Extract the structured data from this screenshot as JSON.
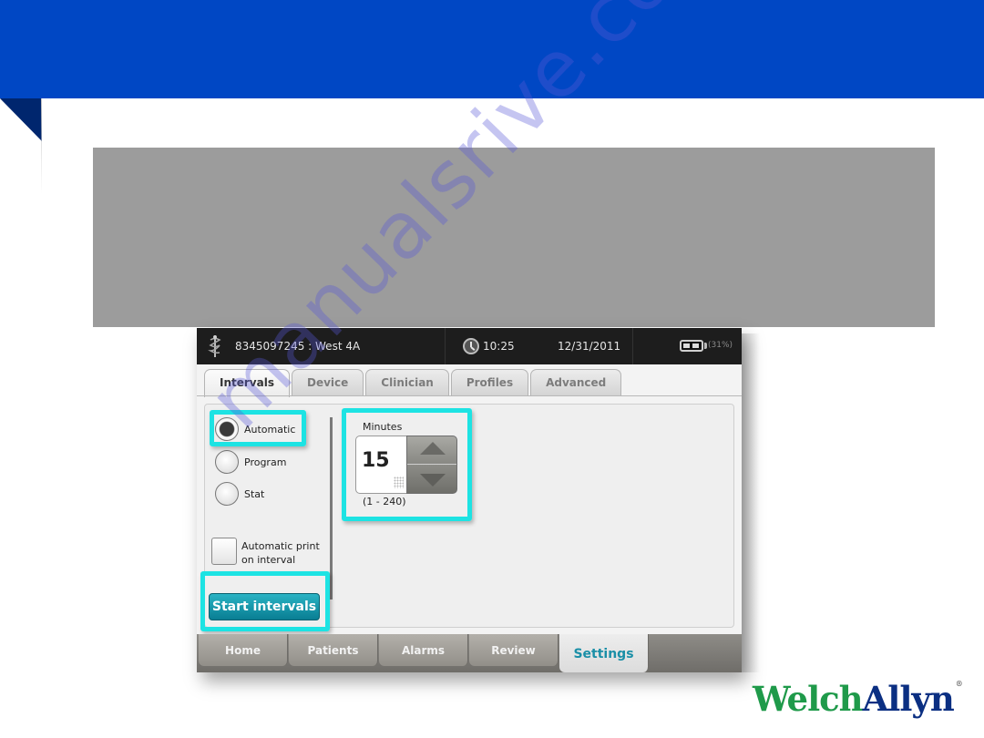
{
  "colors": {
    "top_band": "#0047c4",
    "corner": "#00266e",
    "gray_panel": "#9c9c9c",
    "highlight": "#1de3e3",
    "start_button": "#097e93",
    "settings_active": "#1a8fa7",
    "logo_green": "#1f9a4a",
    "logo_blue": "#0b2f82"
  },
  "status_bar": {
    "icon": "caduceus-icon",
    "patient": "8345097245 : West 4A",
    "time": "10:25",
    "date": "12/31/2011",
    "battery_percent": "(31%)"
  },
  "tabs": [
    {
      "label": "Intervals",
      "active": true
    },
    {
      "label": "Device",
      "active": false
    },
    {
      "label": "Clinician",
      "active": false
    },
    {
      "label": "Profiles",
      "active": false
    },
    {
      "label": "Advanced",
      "active": false
    }
  ],
  "intervals": {
    "modes": [
      {
        "label": "Automatic",
        "selected": true
      },
      {
        "label": "Program",
        "selected": false
      },
      {
        "label": "Stat",
        "selected": false
      }
    ],
    "auto_print_label_line1": "Automatic print",
    "auto_print_label_line2": "on interval",
    "auto_print_checked": false,
    "start_button": "Start intervals",
    "minutes_label": "Minutes",
    "minutes_value": "15",
    "minutes_range": "(1 - 240)"
  },
  "bottom_nav": [
    {
      "label": "Home",
      "active": false
    },
    {
      "label": "Patients",
      "active": false
    },
    {
      "label": "Alarms",
      "active": false
    },
    {
      "label": "Review",
      "active": false
    },
    {
      "label": "Settings",
      "active": true
    }
  ],
  "watermark": "manualsrive.com",
  "logo": {
    "part1": "Welch",
    "part2": "Allyn",
    "reg": "®"
  }
}
